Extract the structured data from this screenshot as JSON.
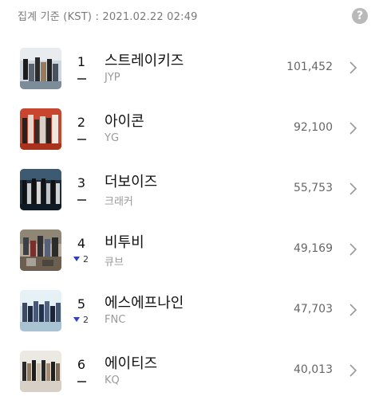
{
  "header": {
    "timestamp": "집계 기준 (KST) : 2021.02.22 02:49",
    "help_label": "?"
  },
  "rows": [
    {
      "rank": "1",
      "name": "스트레이키즈",
      "agency": "JYP",
      "score": "101,452",
      "change": {
        "type": "same",
        "amount": ""
      }
    },
    {
      "rank": "2",
      "name": "아이콘",
      "agency": "YG",
      "score": "92,100",
      "change": {
        "type": "same",
        "amount": ""
      }
    },
    {
      "rank": "3",
      "name": "더보이즈",
      "agency": "크래커",
      "score": "55,753",
      "change": {
        "type": "same",
        "amount": ""
      }
    },
    {
      "rank": "4",
      "name": "비투비",
      "agency": "큐브",
      "score": "49,169",
      "change": {
        "type": "down",
        "amount": "2"
      }
    },
    {
      "rank": "5",
      "name": "에스에프나인",
      "agency": "FNC",
      "score": "47,703",
      "change": {
        "type": "down",
        "amount": "2"
      }
    },
    {
      "rank": "6",
      "name": "에이티즈",
      "agency": "KQ",
      "score": "40,013",
      "change": {
        "type": "same",
        "amount": ""
      }
    }
  ],
  "colors": {
    "down": "#2d3fbf",
    "help_bg": "#b9b9b9"
  }
}
